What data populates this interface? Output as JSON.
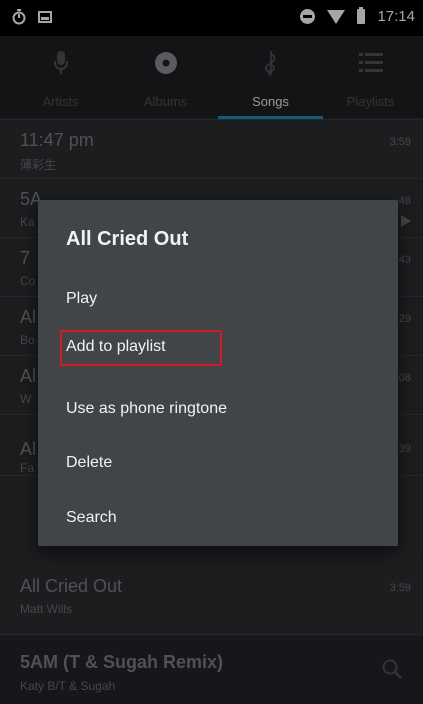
{
  "status_bar": {
    "time": "17:14"
  },
  "tabs": [
    {
      "label": "Artists",
      "icon": "microphone-icon"
    },
    {
      "label": "Albums",
      "icon": "disc-icon"
    },
    {
      "label": "Songs",
      "icon": "treble-clef-icon"
    },
    {
      "label": "Playlists",
      "icon": "playlist-icon"
    }
  ],
  "active_tab": "Songs",
  "songs": [
    {
      "title": "11:47 pm",
      "artist": "薄彩生",
      "duration": "3:59"
    },
    {
      "title": "5A",
      "artist": "Ka",
      "duration": "48"
    },
    {
      "title": "7 ",
      "artist": "Co",
      "duration": "43"
    },
    {
      "title": "Al",
      "artist": "Bo",
      "duration": "29"
    },
    {
      "title": "Al",
      "artist": "W",
      "duration": "08"
    },
    {
      "title": "Al",
      "artist": "Fa",
      "duration": "39"
    },
    {
      "title": "All Cried Out",
      "artist": "Matt Wills",
      "duration": "3:59"
    }
  ],
  "now_playing": {
    "title": "5AM (T & Sugah Remix)",
    "artist": "Katy B/T & Sugah"
  },
  "dialog": {
    "title": "All Cried Out",
    "items": [
      "Play",
      "Add to playlist",
      "Use as phone ringtone",
      "Delete",
      "Search"
    ],
    "highlighted_item": "Add to playlist",
    "highlight_color": "#d11a2a"
  },
  "colors": {
    "accent": "#1f8ec4",
    "dialog_bg": "#424548",
    "list_bg": "#2b2d31"
  }
}
